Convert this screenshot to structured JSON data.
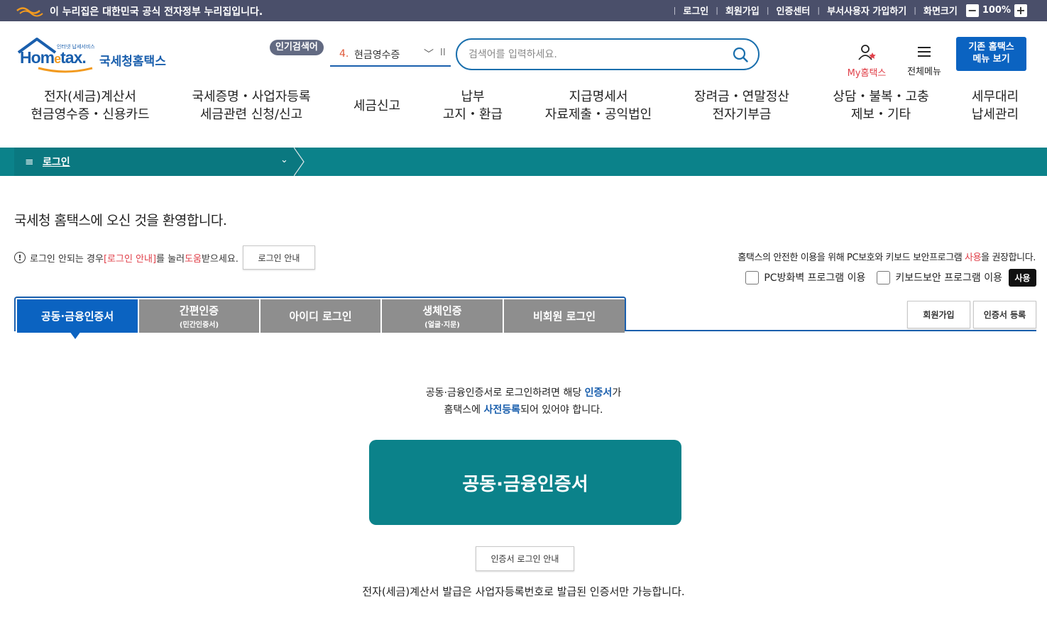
{
  "gov_banner": {
    "text": "이 누리집은 대한민국 공식 전자정부 누리집입니다.",
    "links": [
      "로그인",
      "회원가입",
      "인증센터",
      "부서사용자 가입하기",
      "화면크기"
    ],
    "zoom_level": "100%",
    "zoom_minus": "−",
    "zoom_plus": "+"
  },
  "logo": {
    "small": "인터넷 납세서비스",
    "brand": "Hometax.",
    "name": "국세청홈택스"
  },
  "popular": {
    "badge": "인기검색어",
    "number": "4.",
    "keyword": "현금영수증"
  },
  "search": {
    "placeholder": "검색어를 입력하세요."
  },
  "utility": {
    "my_hometax": "My홈택스",
    "all_menu": "전체메뉴",
    "old_menu_line1": "기존 홈택스",
    "old_menu_line2": "메뉴 보기"
  },
  "gnb": [
    {
      "line1": "전자(세금)계산서",
      "line2": "현금영수증・신용카드"
    },
    {
      "line1": "국세증명・사업자등록",
      "line2": "세금관련 신청/신고"
    },
    {
      "line1": "세금신고",
      "line2": ""
    },
    {
      "line1": "납부",
      "line2": "고지・환급"
    },
    {
      "line1": "지급명세서",
      "line2": "자료제출・공익법인"
    },
    {
      "line1": "장려금・연말정산",
      "line2": "전자기부금"
    },
    {
      "line1": "상담・불복・고충",
      "line2": "제보・기타"
    },
    {
      "line1": "세무대리",
      "line2": "납세관리"
    }
  ],
  "location": {
    "title": "로그인"
  },
  "welcome": "국세청 홈택스에 오신 것을 환영합니다.",
  "help": {
    "prefix": "로그인 안되는 경우 ",
    "link": "[로그인 안내]",
    "mid": "를 눌러 ",
    "help_word": "도움",
    "suffix": "받으세요.",
    "button": "로그인 안내"
  },
  "security": {
    "note_prefix": "홈택스의 안전한 이용을 위해 PC보호와 키보드 보안프로그램 ",
    "note_use": "사용",
    "note_suffix": "을 권장합니다.",
    "firewall": "PC방화벽 프로그램 이용",
    "keyboard": "키보드보안 프로그램 이용",
    "use_button": "사용"
  },
  "tabs": [
    {
      "label": "공동·금융인증서",
      "sub": ""
    },
    {
      "label": "간편인증",
      "sub": "(민간인증서)"
    },
    {
      "label": "아이디 로그인",
      "sub": ""
    },
    {
      "label": "생체인증",
      "sub": "(얼굴·지문)"
    },
    {
      "label": "비회원 로그인",
      "sub": ""
    }
  ],
  "side_buttons": {
    "signup": "회원가입",
    "cert_register": "인증서 등록"
  },
  "cert_info": {
    "line1_prefix": "공동·금융인증서로 로그인하려면 해당 ",
    "line1_em": "인증서",
    "line1_suffix": "가",
    "line2_prefix": "홈택스에 ",
    "line2_em": "사전등록",
    "line2_suffix": "되어 있어야 합니다."
  },
  "cert_button": "공동·금융인증서",
  "cert_guide_button": "인증서 로그인 안내",
  "footnote": "전자(세금)계산서 발급은 사업자등록번호로 발급된 인증서만 가능합니다.",
  "colors": {
    "teal": "#0b828a",
    "blue": "#0b63c1",
    "gov_bar": "#4a4f6a",
    "tab_gray": "#8e8e8e"
  }
}
